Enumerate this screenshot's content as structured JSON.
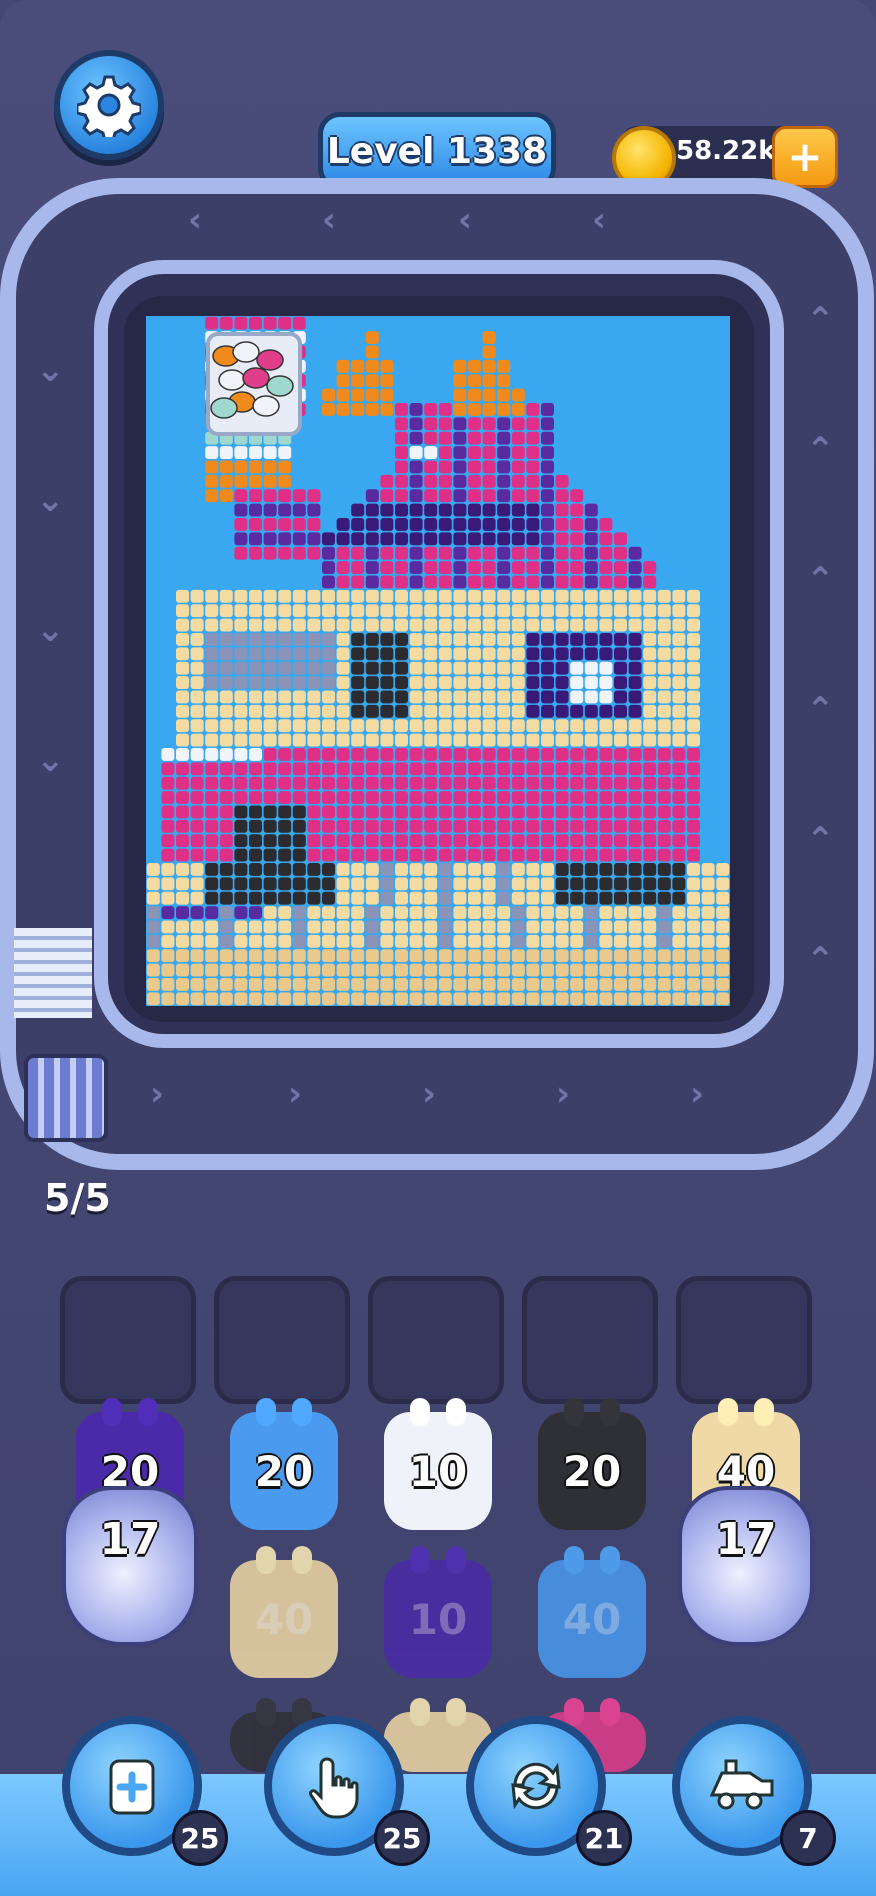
{
  "header": {
    "level_label": "Level 1338",
    "coins": "58.22k",
    "coin_add": "+"
  },
  "conveyor": {
    "counter": "5/5"
  },
  "slots": [
    "",
    "",
    "",
    "",
    ""
  ],
  "pieces": {
    "row1": [
      "20",
      "20",
      "10",
      "20",
      "40"
    ],
    "capsules": [
      "17",
      "17"
    ],
    "row2": [
      "40",
      "10",
      "40"
    ]
  },
  "boosters": [
    {
      "icon": "add-slot-icon",
      "count": "25"
    },
    {
      "icon": "hand-pointer-icon",
      "count": "25"
    },
    {
      "icon": "shuffle-icon",
      "count": "21"
    },
    {
      "icon": "train-icon",
      "count": "7"
    }
  ],
  "colors": {
    "background": "#454873",
    "track": "#a8b8ea",
    "board_sky": "#3aa8f0",
    "accent_blue": "#2d88e6",
    "coin_gold": "#f5b400"
  }
}
